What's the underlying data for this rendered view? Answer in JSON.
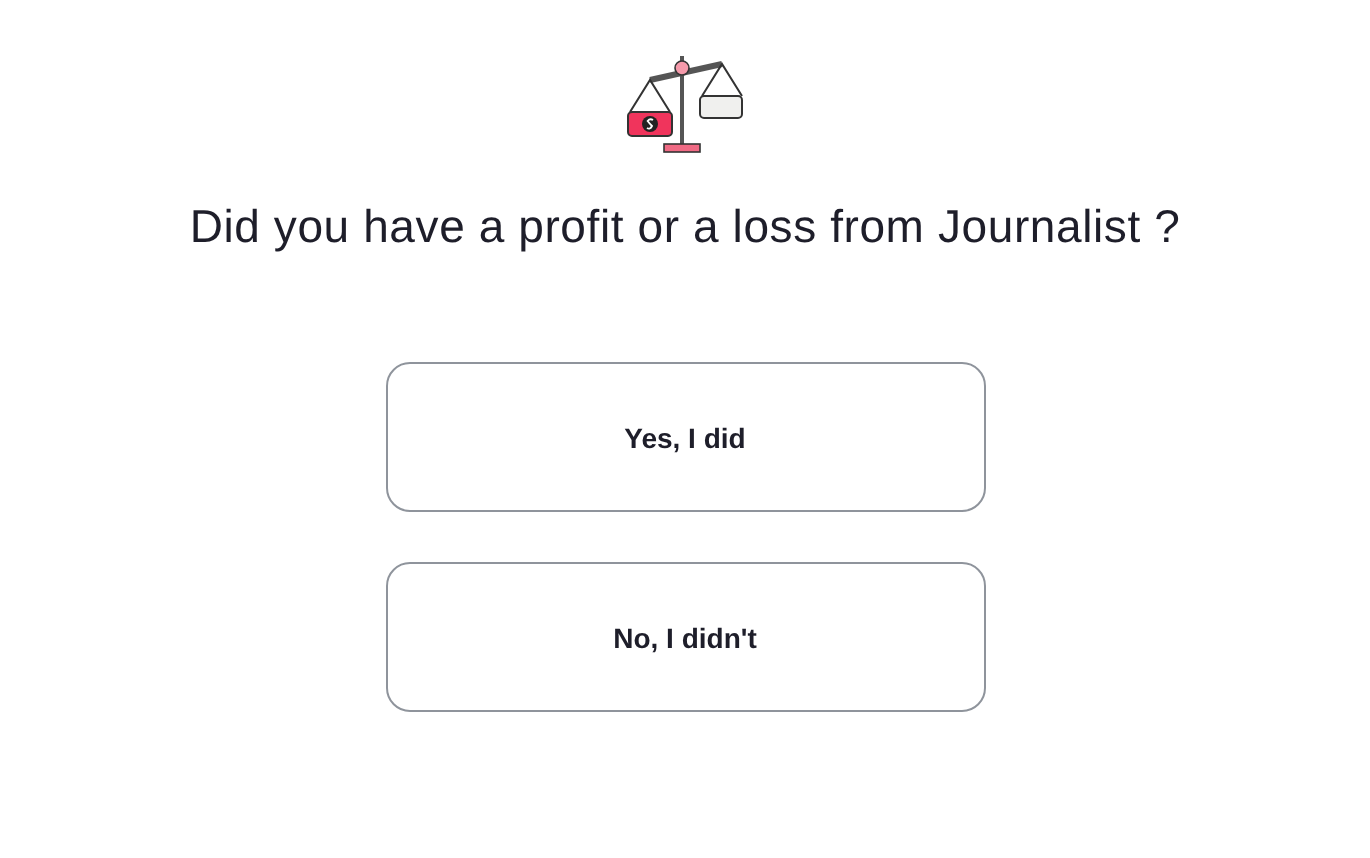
{
  "question": "Did you have a profit or a loss from Journalist ?",
  "options": [
    {
      "label": "Yes, I did"
    },
    {
      "label": "No, I didn't"
    }
  ]
}
